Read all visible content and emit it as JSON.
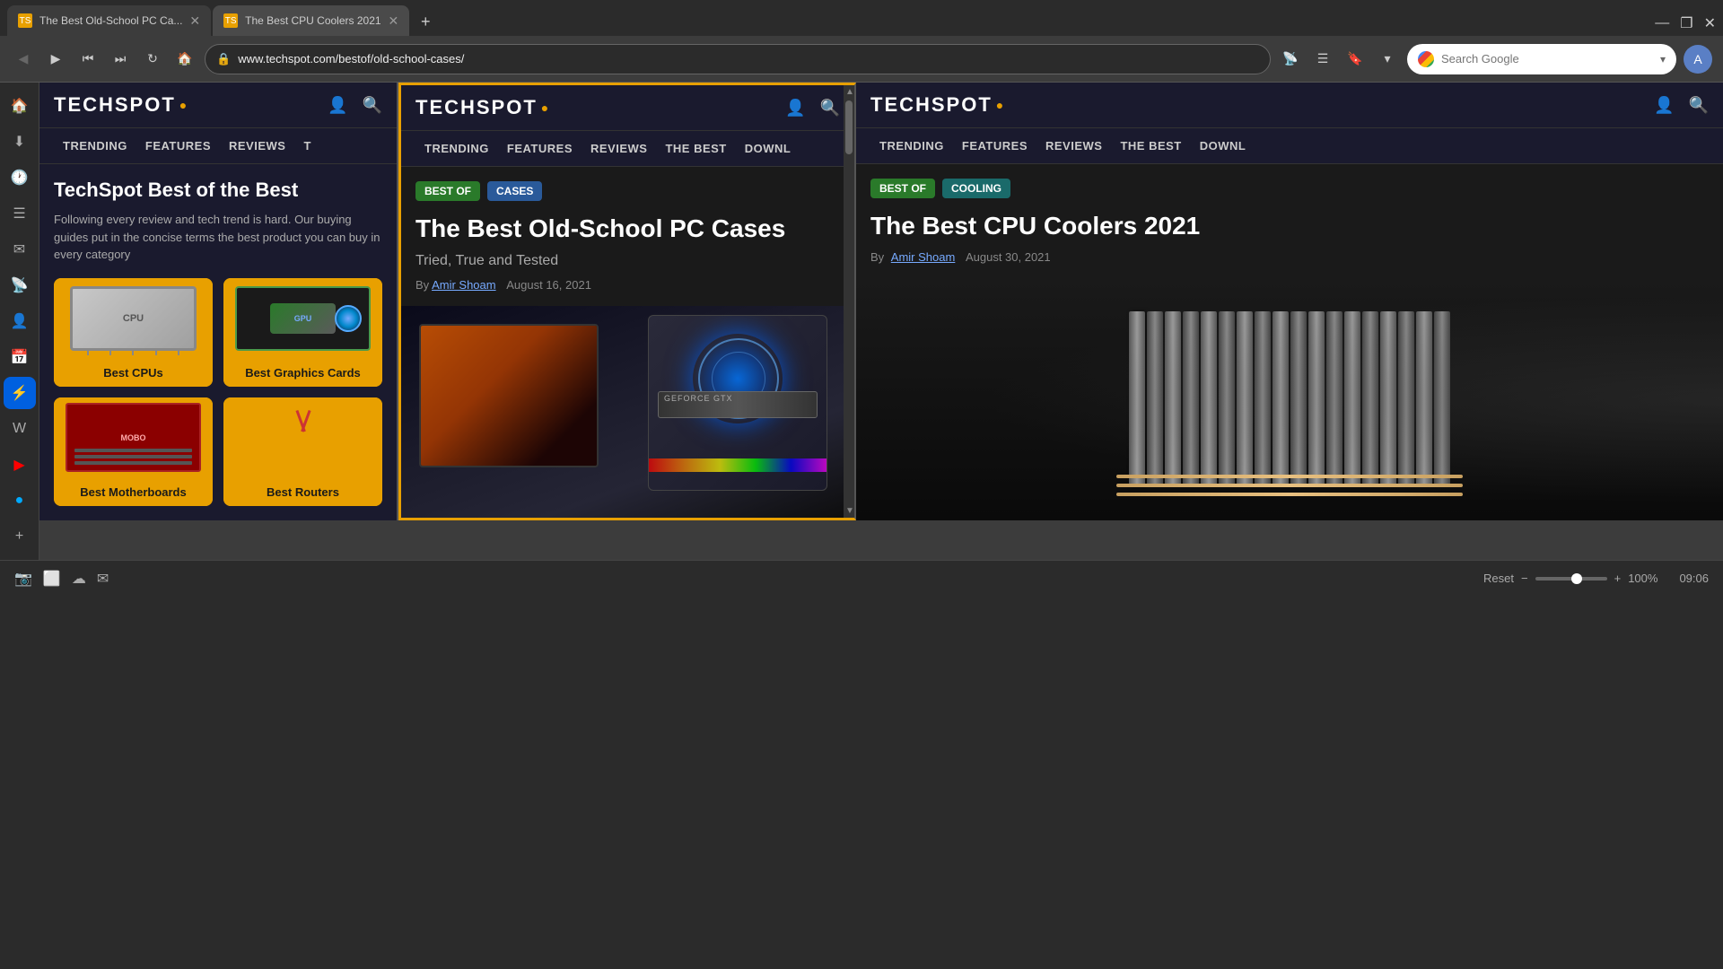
{
  "browser": {
    "tabs": [
      {
        "id": "tab1",
        "title": "The Best Old-School PC Ca...",
        "url": "www.techspot.com/bestof/old-school-cases/",
        "active": false,
        "favicon": "TS"
      },
      {
        "id": "tab2",
        "title": "The Best CPU Coolers 2021",
        "active": true,
        "favicon": "TS"
      }
    ],
    "url": "www.techspot.com/bestof/old-school-cases/",
    "search_placeholder": "Search Google",
    "window_controls": {
      "minimize": "—",
      "maximize": "❐",
      "close": "✕"
    }
  },
  "sidebar_left": {
    "icons": [
      {
        "name": "home",
        "symbol": "🏠"
      },
      {
        "name": "download",
        "symbol": "⬇"
      },
      {
        "name": "clock",
        "symbol": "🕐"
      },
      {
        "name": "list",
        "symbol": "☰"
      },
      {
        "name": "mail",
        "symbol": "✉"
      },
      {
        "name": "rss",
        "symbol": "📡"
      },
      {
        "name": "person",
        "symbol": "👤"
      },
      {
        "name": "calendar",
        "symbol": "📅"
      },
      {
        "name": "pocket",
        "symbol": "⚡"
      },
      {
        "name": "wiki",
        "symbol": "W"
      },
      {
        "name": "youtube",
        "symbol": "▶"
      },
      {
        "name": "active",
        "symbol": "●"
      },
      {
        "name": "add",
        "symbol": "+"
      }
    ]
  },
  "left_pane": {
    "header": {
      "logo_text": "TECHSPOT",
      "logo_suffix": "●"
    },
    "nav": [
      "TRENDING",
      "FEATURES",
      "REVIEWS",
      "T"
    ],
    "title": "TechSpot Best of the Best",
    "description": "Following every review and tech trend is hard. Our buying guides put in the concise terms the best product you can buy in every category",
    "grid": [
      {
        "label": "Best CPUs",
        "icon": "🖥"
      },
      {
        "label": "Best Graphics Cards",
        "icon": "🎮"
      },
      {
        "label": "Best Motherboards",
        "icon": "🔌"
      },
      {
        "label": "Best Routers",
        "icon": "📡"
      }
    ]
  },
  "middle_pane": {
    "header": {
      "logo_text": "TECHSPOT",
      "logo_suffix": "●"
    },
    "nav": [
      "TRENDING",
      "FEATURES",
      "REVIEWS",
      "THE BEST",
      "DOWNL"
    ],
    "badge1": "BEST OF",
    "badge2": "CASES",
    "title": "The Best Old-School PC Cases",
    "subtitle": "Tried, True and Tested",
    "author": "Amir Shoam",
    "date": "August 16, 2021",
    "by": "By"
  },
  "right_pane": {
    "header": {
      "logo_text": "TECHSPOT",
      "logo_suffix": "●"
    },
    "nav": [
      "TRENDING",
      "FEATURES",
      "REVIEWS",
      "THE BEST",
      "DOWNL"
    ],
    "badge1": "BEST OF",
    "badge2": "COOLING",
    "title": "The Best CPU Coolers 2021",
    "author": "Amir Shoam",
    "date": "August 30, 2021",
    "by": "By"
  },
  "bottom_bar": {
    "zoom_label": "100%",
    "reset_label": "Reset",
    "time": "09:06"
  }
}
